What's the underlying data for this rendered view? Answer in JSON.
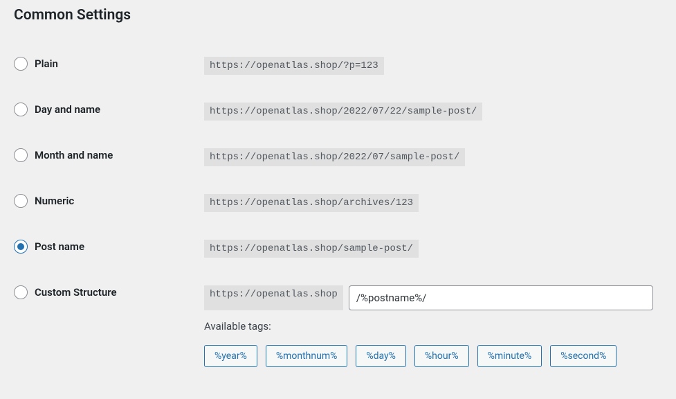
{
  "heading": "Common Settings",
  "options": {
    "plain": {
      "label": "Plain",
      "example": "https://openatlas.shop/?p=123",
      "selected": false
    },
    "day_name": {
      "label": "Day and name",
      "example": "https://openatlas.shop/2022/07/22/sample-post/",
      "selected": false
    },
    "month_name": {
      "label": "Month and name",
      "example": "https://openatlas.shop/2022/07/sample-post/",
      "selected": false
    },
    "numeric": {
      "label": "Numeric",
      "example": "https://openatlas.shop/archives/123",
      "selected": false
    },
    "post_name": {
      "label": "Post name",
      "example": "https://openatlas.shop/sample-post/",
      "selected": true
    },
    "custom": {
      "label": "Custom Structure",
      "prefix": "https://openatlas.shop",
      "value": "/%postname%/",
      "selected": false
    }
  },
  "available_tags_label": "Available tags:",
  "tags": [
    "%year%",
    "%monthnum%",
    "%day%",
    "%hour%",
    "%minute%",
    "%second%"
  ]
}
